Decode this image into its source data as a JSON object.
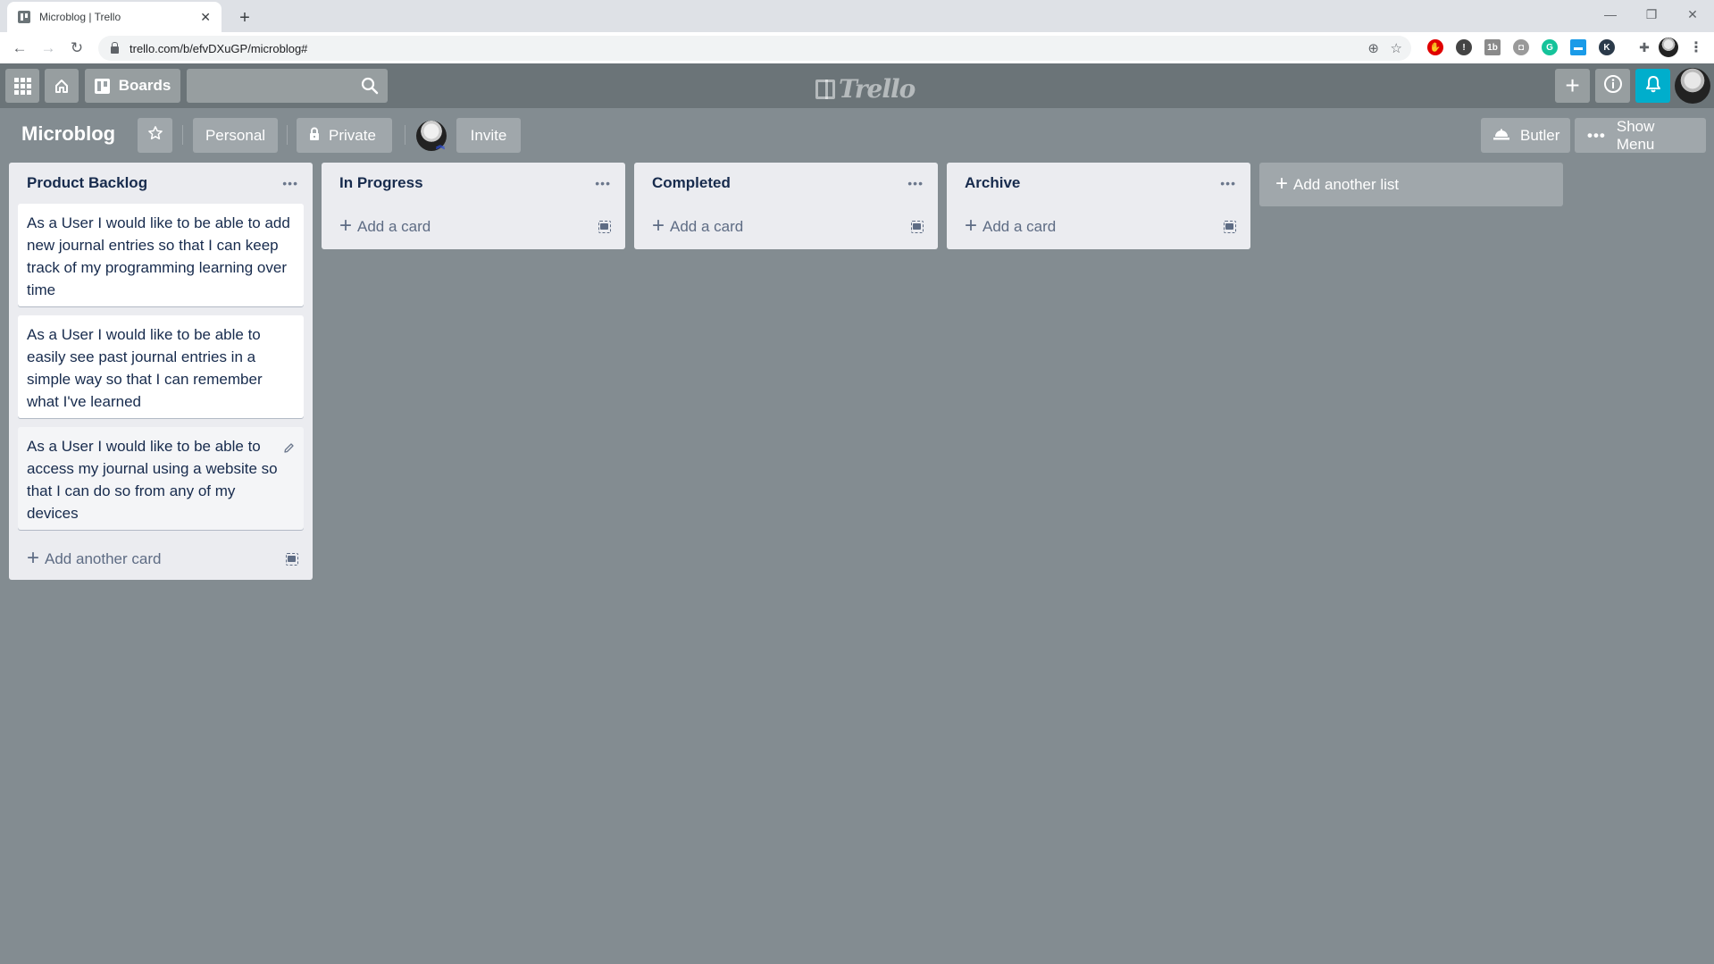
{
  "browser": {
    "tab_title": "Microblog | Trello",
    "url": "trello.com/b/efvDXuGP/microblog#",
    "extensions": [
      {
        "name": "adblock-icon",
        "color": "#e00000",
        "glyph": "✋"
      },
      {
        "name": "1password-icon",
        "color": "#444444",
        "glyph": "!"
      },
      {
        "name": "toby-icon",
        "color": "#8a8a8a",
        "glyph": "1b"
      },
      {
        "name": "camera-icon",
        "color": "#9a9a9a",
        "glyph": "◘"
      },
      {
        "name": "grammarly-icon",
        "color": "#15c39a",
        "glyph": "G"
      },
      {
        "name": "folder-extension-icon",
        "color": "#1a9be8",
        "glyph": "▬"
      },
      {
        "name": "k-extension-icon",
        "color": "#2b3a4a",
        "glyph": "K"
      }
    ]
  },
  "header": {
    "boards_label": "Boards",
    "search_placeholder": "",
    "logo_text": "Trello",
    "notification_color": "#00aecc"
  },
  "board": {
    "title": "Microblog",
    "visibility_team": "Personal",
    "privacy": "Private",
    "invite_label": "Invite",
    "butler_label": "Butler",
    "show_menu_label": "Show Menu",
    "background_color": "#838c91"
  },
  "lists": [
    {
      "title": "Product Backlog",
      "cards": [
        "As a User I would like to be able to add new journal entries so that I can keep track of my programming learning over time",
        "As a User I would like to be able to easily see past journal entries in a simple way so that I can remember what I've learned",
        "As a User I would like to be able to access my journal using a website so that I can do so from any of my devices"
      ],
      "add_label": "Add another card"
    },
    {
      "title": "In Progress",
      "cards": [],
      "add_label": "Add a card"
    },
    {
      "title": "Completed",
      "cards": [],
      "add_label": "Add a card"
    },
    {
      "title": "Archive",
      "cards": [],
      "add_label": "Add a card"
    }
  ],
  "add_list_label": "Add another list"
}
